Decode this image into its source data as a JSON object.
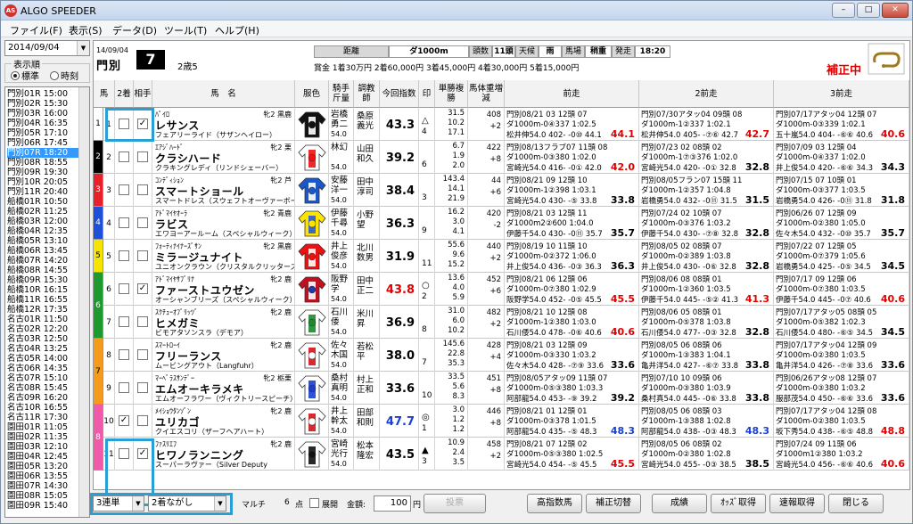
{
  "window": {
    "title": "ALGO SPEEDER",
    "icon": "AS"
  },
  "menu": [
    "ファイル(F)",
    "表示(S)",
    "データ(D)",
    "ツール(T)",
    "ヘルプ(H)"
  ],
  "left": {
    "date": "2014/09/04",
    "order_label": "表示順",
    "radio_std": "標準",
    "radio_time": "時刻",
    "races": [
      "門別01R 15:00",
      "門別02R 15:30",
      "門別03R 16:00",
      "門別04R 16:35",
      "門別05R 17:10",
      "門別06R 17:45",
      "門別07R 18:20",
      "門別08R 18:55",
      "門別09R 19:30",
      "門別10R 20:05",
      "門別11R 20:40",
      "船橋01R 10:50",
      "船橋02R 11:25",
      "船橋03R 12:00",
      "船橋04R 12:35",
      "船橋05R 13:10",
      "船橋06R 13:45",
      "船橋07R 14:20",
      "船橋08R 14:55",
      "船橋09R 15:30",
      "船橋10R 16:15",
      "船橋11R 16:55",
      "船橋12R 17:35",
      "名古01R 11:50",
      "名古02R 12:20",
      "名古03R 12:50",
      "名古04R 13:25",
      "名古05R 14:00",
      "名古06R 14:35",
      "名古07R 15:10",
      "名古08R 15:45",
      "名古09R 16:20",
      "名古10R 16:55",
      "名古11R 17:30",
      "園田01R 11:05",
      "園田02R 11:35",
      "園田03R 12:10",
      "園田04R 12:45",
      "園田05R 13:20",
      "園田06R 13:55",
      "園田07R 14:30",
      "園田08R 15:05",
      "園田09R 15:40"
    ]
  },
  "header": {
    "date": "14/09/04",
    "venue": "門別",
    "race_no": "7",
    "class": "2歳5",
    "dist_label": "距離",
    "dist_val": "ダ1000m",
    "count_label": "頭数",
    "count_val": "11頭",
    "weather_label": "天候",
    "weather_val": "雨",
    "track_label": "馬場",
    "track_val": "稍重",
    "start_label": "発走",
    "start_val": "18:20",
    "prizes": "賞金 1着30万円  2着60,000円  3着45,000円  4着30,000円  5着15,000円",
    "correcting": "補正中"
  },
  "columns": [
    "馬",
    "2着",
    "相手",
    "馬　名",
    "服色",
    "騎手斤量",
    "調教師",
    "今回指数",
    "印",
    "単勝複勝",
    "馬体重増減",
    "前走",
    "2前走",
    "3前走"
  ],
  "horses": [
    {
      "num": "1",
      "c2": false,
      "opp": true,
      "sire": "ﾊﾟｲﾛ",
      "sex": "牝2 黒鹿",
      "name": "レサンス",
      "dam": "フェアリーライド（サザンヘイロー）",
      "jockey": "岩橋勇二",
      "jw": "54.0",
      "trainer": "桑原義光",
      "idx": "43.3",
      "idxred": false,
      "mk": "△",
      "mk2": "4",
      "odds": [
        "31.5",
        "10.2",
        "17.1"
      ],
      "wt": [
        "408",
        "+2"
      ],
      "p1": [
        "門別08/21  03 12頭 07",
        "ダ1000m-0④337 1:02.5",
        "松井伸54.0 402- -0⑩ 44.1"
      ],
      "p1i": "44.1",
      "p1r": true,
      "p2": [
        "門別07/30アタッ04 09頭 08",
        "ダ1000m-1②337 1:02.1",
        "松井伸54.0 405- -⑦⑥ 42.7"
      ],
      "p2i": "42.7",
      "p2r": true,
      "p3": [
        "門別07/17アタッ04 12頭 07",
        "ダ1000m-0③339 1:02.1",
        "五十嵐54.0 404- -⑥⑥ 40.6"
      ],
      "p3i": "40.6",
      "p3r": true
    },
    {
      "num": "2",
      "c2": false,
      "opp": false,
      "sire": "ｴｱｼﾞﾊｰﾄﾞ",
      "sex": "牝2 栗",
      "name": "クラシハード",
      "dam": "クラキングレディ（リンドシェーバー）",
      "jockey": "林幻",
      "jw": "54.0",
      "trainer": "山田和久",
      "idx": "39.2",
      "idxred": false,
      "mk": "",
      "mk2": "6",
      "odds": [
        "6.7",
        "1.9",
        "2.0"
      ],
      "wt": [
        "422",
        "+8"
      ],
      "p1": [
        "門別08/13フラブ07 11頭 08",
        "ダ1000m-0③380 1:02.0",
        "宮崎光54.0 416- -0① 42.0"
      ],
      "p1i": "42.0",
      "p1r": true,
      "p2": [
        "門別07/23  02 08頭 02",
        "ダ1000m-1⑦③376 1:02.0",
        "宮崎光54.0 420- -0① 32.8"
      ],
      "p2i": "32.8",
      "p2r": false,
      "p3": [
        "門別07/09  03 12頭 04",
        "ダ1000m-0④337 1:02.0",
        "井上俊54.0 420- -⑥⑥ 34.3"
      ],
      "p3i": "34.3",
      "p3r": false
    },
    {
      "num": "3",
      "c2": false,
      "opp": false,
      "sire": "ｺﾝﾃﾞｨｼｮﾝ",
      "sex": "牝2 芦",
      "name": "スマートショール",
      "dam": "スマートドレス（スウェフトオーヴァーボー",
      "jockey": "安藤洋一",
      "jw": "54.0",
      "trainer": "田中淳司",
      "idx": "38.4",
      "idxred": false,
      "mk": "",
      "mk2": "3",
      "odds": [
        "143.4",
        "14.1",
        "21.9"
      ],
      "wt": [
        "44",
        "+6"
      ],
      "p1": [
        "門別08/21  09 12頭 10",
        "ダ1000m-1②398 1:03.1",
        "宮崎光54.0 430- -⑤ 33.8"
      ],
      "p1i": "33.8",
      "p1r": false,
      "p2": [
        "門別08/05フラン07 15頭 11",
        "ダ1000m-1②357 1:04.8",
        "岩橋勇54.0 432- -0⑪ 31.5"
      ],
      "p2i": "31.5",
      "p2r": false,
      "p3": [
        "門別07/15  07 10頭 01",
        "ダ1000m-0③377 1:03.5",
        "岩橋勇54.0 426- -0⑪ 31.8"
      ],
      "p3i": "31.8",
      "p3r": false
    },
    {
      "num": "4",
      "c2": false,
      "opp": false,
      "sire": "ｱﾄﾞﾏｲﾔｵｰﾗ",
      "sex": "牝2 青鹿",
      "name": "ラビス",
      "dam": "エワヨーアールーム（スペシャルウィーク）",
      "jockey": "伊藤千尋",
      "jw": "54.0",
      "trainer": "小野望",
      "idx": "36.3",
      "idxred": false,
      "mk": "",
      "mk2": "9",
      "odds": [
        "16.2",
        "3.0",
        "4.1"
      ],
      "wt": [
        "420",
        "-2"
      ],
      "p1": [
        "門別08/21  03 12頭 11",
        "ダ1000m2②600 1:04.0",
        "伊藤千54.0 430- -0⑪ 35.7"
      ],
      "p1i": "35.7",
      "p1r": false,
      "p2": [
        "門別07/24  02 10頭 07",
        "ダ1000m-0③376 1:03.2",
        "伊藤千54.0 430- -⑦⑧ 32.8"
      ],
      "p2i": "32.8",
      "p2r": false,
      "p3": [
        "門別06/26  07 12頭 09",
        "ダ1000m-0②380 1:05.0",
        "佐々木54.0 432- -0⑩ 35.7"
      ],
      "p3i": "35.7",
      "p3r": false
    },
    {
      "num": "5",
      "c2": false,
      "opp": false,
      "sire": "ﾌｫｰﾃｨﾅｲﾅｰｽﾞｻﾝ",
      "sex": "牝2 黒鹿",
      "name": "ミラージュナイト",
      "dam": "ユニオンクラウン（クリスタルクリッターズ）",
      "jockey": "井上俊彦",
      "jw": "54.0",
      "trainer": "北川数男",
      "idx": "31.9",
      "idxred": false,
      "mk": "",
      "mk2": "11",
      "odds": [
        "55.6",
        "9.6",
        "15.2"
      ],
      "wt": [
        "440",
        "+2"
      ],
      "p1": [
        "門別08/19  10 11頭 10",
        "ダ1000m-0②372 1:06.0",
        "井上俊54.0 436- -0③ 36.3"
      ],
      "p1i": "36.3",
      "p1r": false,
      "p2": [
        "門別08/05  02 08頭 07",
        "ダ1000m-0②389 1:03.8",
        "井上俊54.0 430- -0⑥ 32.8"
      ],
      "p2i": "32.8",
      "p2r": false,
      "p3": [
        "門別07/22  07 12頭 05",
        "ダ1000m-0⑦379 1:05.6",
        "岩橋勇54.0 425- -0⑤ 34.5"
      ],
      "p3i": "34.5",
      "p3r": false
    },
    {
      "num": "6",
      "c2": false,
      "opp": true,
      "sire": "ｱﾄﾞﾏｲﾔｻﾌﾞﾘﾅ",
      "sex": "牝2 鹿",
      "name": "ファーストユウゼン",
      "dam": "オーシャンブリーズ（スペシャルウィーク）",
      "jockey": "阪野学",
      "jw": "54.0",
      "trainer": "田中正二",
      "idx": "43.8",
      "idxred": true,
      "mk": "○",
      "mk2": "2",
      "odds": [
        "13.6",
        "4.0",
        "5.9"
      ],
      "wt": [
        "452",
        "+6"
      ],
      "p1": [
        "門別08/21  06 12頭 06",
        "ダ1000m-0⑦380 1:02.9",
        "阪野学54.0 452- -0⑤ 45.5"
      ],
      "p1i": "45.5",
      "p1r": true,
      "p2": [
        "門別08/06  08 08頭 01",
        "ダ1000m-1②360 1:03.5",
        "伊藤千54.0 445- -⑤② 41.3"
      ],
      "p2i": "41.3",
      "p2r": true,
      "p3": [
        "門別07/17  09 12頭 06",
        "ダ1000m-0⑦380 1:03.5",
        "伊藤千54.0 445- -0⑦ 40.6"
      ],
      "p3i": "40.6",
      "p3r": true
    },
    {
      "num": "7",
      "c2": false,
      "opp": false,
      "sire": "ｽｸﾁｭｰｵﾌﾞﾘｯﾂﾞ",
      "sex": "牝2 鹿",
      "name": "ヒメガミ",
      "dam": "ビモアタソンスラ（デモア）",
      "jockey": "石川倭",
      "jw": "54.0",
      "trainer": "米川昇",
      "idx": "36.9",
      "idxred": false,
      "mk": "",
      "mk2": "8",
      "odds": [
        "31.0",
        "6.0",
        "10.2"
      ],
      "wt": [
        "482",
        "+2"
      ],
      "p1": [
        "門別08/21  10 12頭 08",
        "ダ1000m-1②380 1:03.0",
        "石川倭54.0 478- -0⑥ 40.6"
      ],
      "p1i": "40.6",
      "p1r": true,
      "p2": [
        "門別08/06  05 08頭 01",
        "ダ1000m-0⑤378 1:03.8",
        "石川倭54.0 477- -0③ 32.8"
      ],
      "p2i": "32.8",
      "p2r": false,
      "p3": [
        "門別07/17アタッ05 08頭 05",
        "ダ1000m-0⑤382 1:02.3",
        "石川倭54.0 480- -⑥⑤ 34.5"
      ],
      "p3i": "34.5",
      "p3r": false
    },
    {
      "num": "8",
      "c2": false,
      "opp": false,
      "sire": "ｽﾏｰﾄﾛｰｲ",
      "sex": "牝2 鹿",
      "name": "フリーランス",
      "dam": "ムービングアウト（Langfuhr）",
      "jockey": "佐々木国",
      "jw": "54.0",
      "trainer": "若松平",
      "idx": "38.0",
      "idxred": false,
      "mk": "",
      "mk2": "7",
      "odds": [
        "145.6",
        "22.8",
        "35.3"
      ],
      "wt": [
        "428",
        "+4"
      ],
      "p1": [
        "門別08/21  03 12頭 09",
        "ダ1000m-0③330 1:03.2",
        "佐々木54.0 428- -⑦⑨ 33.6"
      ],
      "p1i": "33.6",
      "p1r": false,
      "p2": [
        "門別08/05  06 08頭 06",
        "ダ1000m-1③383 1:04.1",
        "亀井洋54.0 427- -⑥⑦ 33.8"
      ],
      "p2i": "33.8",
      "p2r": false,
      "p3": [
        "門別07/17アタッ04 12頭 09",
        "ダ1000m-0②380 1:03.5",
        "亀井洋54.0 426- -⑦⑧ 33.6"
      ],
      "p3i": "33.6",
      "p3r": false
    },
    {
      "num": "9",
      "c2": false,
      "opp": false,
      "sire": "ﾏｰﾍﾞﾗｽｻﾝﾃﾞｰ",
      "sex": "牝2 栃栗",
      "name": "エムオーキラメキ",
      "dam": "エムオーフラワー（ヴィクトリースピーチ）",
      "jockey": "桑村真明",
      "jw": "54.0",
      "trainer": "村上正和",
      "idx": "33.6",
      "idxred": false,
      "mk": "",
      "mk2": "10",
      "odds": [
        "33.5",
        "5.6",
        "8.3"
      ],
      "wt": [
        "451",
        "+8"
      ],
      "p1": [
        "門別08/05アタッ09 11頭 07",
        "ダ1000m-0⑤③380 1:03.3",
        "阿部龍54.0 453- -⑨ 39.2"
      ],
      "p1i": "39.2",
      "p1r": false,
      "p2": [
        "門別07/10  10 09頭 06",
        "ダ1000m-0③380 1:03.9",
        "桑村真54.0 445- -0⑥ 33.8"
      ],
      "p2i": "33.8",
      "p2r": false,
      "p3": [
        "門別06/26アタッ08 12頭 07",
        "ダ1000m-0③380 1:03.2",
        "服部茂54.0 450- -⑥⑥ 33.6"
      ],
      "p3i": "33.6",
      "p3r": false
    },
    {
      "num": "10",
      "c2": true,
      "opp": false,
      "sire": "ﾒｲｼｮｳﾀﾝｿﾞﾝ",
      "sex": "牝2 鹿",
      "name": "ユリカゴ",
      "dam": "クイエスコリ（ザーフヘアハート）",
      "jockey": "井上幹太",
      "jw": "54.0",
      "trainer": "田部和則",
      "idx": "47.7",
      "idxred": false,
      "idxblue": true,
      "mk": "◎",
      "mk2": "1",
      "odds": [
        "3.0",
        "1.2",
        "1.2"
      ],
      "wt": [
        "446",
        "+8"
      ],
      "p1": [
        "門別08/21  01 12頭 01",
        "ダ1000m-0③378 1:01.5",
        "阿部龍54.0 435- -⑤ 48.3"
      ],
      "p1i": "48.3",
      "p1r": false,
      "p1b": true,
      "p2": [
        "門別08/05  06 08頭 03",
        "ダ1000m-1③388 1:02.8",
        "阿部龍54.0 438- -0③ 48.3"
      ],
      "p2i": "48.3",
      "p2r": false,
      "p2b": true,
      "p3": [
        "門別07/17アタッ04 12頭 08",
        "ダ1000m-0②380 1:03.5",
        "坂下秀54.0 438- -⑥⑤ 48.8"
      ],
      "p3i": "48.8",
      "p3r": true
    },
    {
      "num": "11",
      "c2": false,
      "opp": true,
      "sire": "ﾌｧｽﾘｴﾌ",
      "sex": "牝2 鹿",
      "name": "ヒワノランニング",
      "dam": "スーパーラヴァー（Silver Deputy",
      "jockey": "宮崎光行",
      "jw": "54.0",
      "trainer": "松本隆宏",
      "idx": "43.5",
      "idxred": false,
      "mk": "▲",
      "mk2": "3",
      "odds": [
        "10.9",
        "2.4",
        "3.5"
      ],
      "wt": [
        "458",
        "+2"
      ],
      "p1": [
        "門別08/21  07 12頭 02",
        "ダ1000m-0⑤③380 1:02.5",
        "宮崎光54.0 454- -⑤ 45.5"
      ],
      "p1i": "45.5",
      "p1r": true,
      "p2": [
        "門別08/05  06 08頭 02",
        "ダ1000m-0②380 1:02.8",
        "宮崎光54.0 455- -0③ 38.5"
      ],
      "p2i": "38.5",
      "p2r": false,
      "p3": [
        "門別07/24  09 11頭 06",
        "ダ1000m1②380 1:03.2",
        "宮崎光54.0 456- -⑥⑥ 40.6"
      ],
      "p3i": "40.6",
      "p3r": true
    }
  ],
  "frames": [
    {
      "label": "1",
      "color": "#ffffff",
      "rows": 1,
      "text": "#000"
    },
    {
      "label": "2",
      "color": "#000000",
      "rows": 1,
      "text": "#fff"
    },
    {
      "label": "3",
      "color": "#e8202a",
      "rows": 1,
      "text": "#fff"
    },
    {
      "label": "4",
      "color": "#1e4fd8",
      "rows": 1,
      "text": "#fff"
    },
    {
      "label": "5",
      "color": "#f4e400",
      "rows": 1,
      "text": "#000"
    },
    {
      "label": "6",
      "color": "#1c9a2e",
      "rows": 2,
      "text": "#fff"
    },
    {
      "label": "7",
      "color": "#f59a1a",
      "rows": 2,
      "text": "#000"
    },
    {
      "label": "8",
      "color": "#f05aa8",
      "rows": 2,
      "text": "#fff"
    }
  ],
  "bottom": {
    "bet_type": "3連単",
    "method": "2着ながし",
    "multi": "マルチ",
    "points": "6",
    "points_unit": "点",
    "expand": "展開",
    "amount_label": "金額:",
    "amount": "100",
    "amount_unit": "円",
    "buttons": [
      "投票",
      "高指数馬",
      "補正切替",
      "成績",
      "ｵｯｽﾞ取得",
      "速報取得",
      "閉じる"
    ]
  },
  "colors": {
    "accent": "#2a9fd6",
    "red": "#e30000",
    "blue": "#1a3fd0"
  }
}
